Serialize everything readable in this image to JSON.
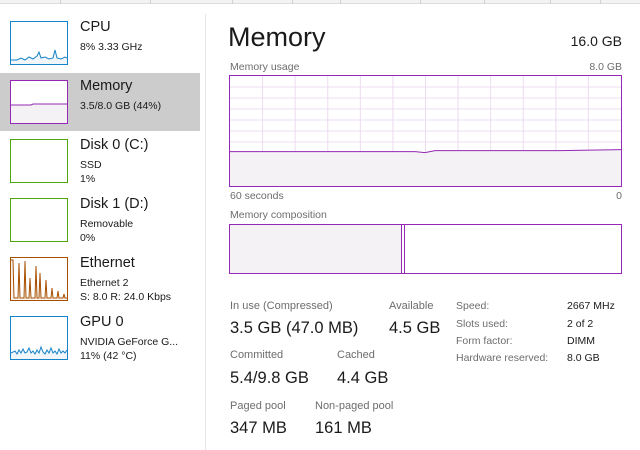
{
  "colors": {
    "memory_accent": "#9528b4",
    "memory_fill": "#f4f2f4",
    "cpu_accent": "#1583c7",
    "disk_accent": "#4da60c",
    "ethernet_accent": "#a74f01",
    "gpu_accent": "#1583c7",
    "selected_bg": "#cccccc"
  },
  "sidebar": {
    "items": [
      {
        "title": "CPU",
        "sub1": "8% 3.33 GHz",
        "sub2": "",
        "icon": "cpu-graph-icon",
        "selected": false
      },
      {
        "title": "Memory",
        "sub1": "3.5/8.0 GB (44%)",
        "sub2": "",
        "icon": "memory-graph-icon",
        "selected": true
      },
      {
        "title": "Disk 0 (C:)",
        "sub1": "SSD",
        "sub2": "1%",
        "icon": "disk-graph-icon",
        "selected": false
      },
      {
        "title": "Disk 1 (D:)",
        "sub1": "Removable",
        "sub2": "0%",
        "icon": "disk-graph-icon",
        "selected": false
      },
      {
        "title": "Ethernet",
        "sub1": "Ethernet 2",
        "sub2": "S: 8.0 R: 24.0 Kbps",
        "icon": "ethernet-graph-icon",
        "selected": false
      },
      {
        "title": "GPU 0",
        "sub1": "NVIDIA GeForce G...",
        "sub2": "11% (42 °C)",
        "icon": "gpu-graph-icon",
        "selected": false
      }
    ]
  },
  "main": {
    "title": "Memory",
    "total": "16.0 GB",
    "usage_graph": {
      "label": "Memory usage",
      "max_label": "8.0 GB",
      "time_label": "60 seconds",
      "end_label": "0",
      "usage_fraction": 0.44
    },
    "composition": {
      "label": "Memory composition",
      "in_use_fraction": 0.44
    },
    "stats": {
      "in_use_label": "In use (Compressed)",
      "in_use_value": "3.5 GB (47.0 MB)",
      "available_label": "Available",
      "available_value": "4.5 GB",
      "committed_label": "Committed",
      "committed_value": "5.4/9.8 GB",
      "cached_label": "Cached",
      "cached_value": "4.4 GB",
      "paged_label": "Paged pool",
      "paged_value": "347 MB",
      "nonpaged_label": "Non-paged pool",
      "nonpaged_value": "161 MB"
    },
    "specs": [
      {
        "label": "Speed:",
        "value": "2667 MHz"
      },
      {
        "label": "Slots used:",
        "value": "2 of 2"
      },
      {
        "label": "Form factor:",
        "value": "DIMM"
      },
      {
        "label": "Hardware reserved:",
        "value": "8.0 GB"
      }
    ]
  }
}
